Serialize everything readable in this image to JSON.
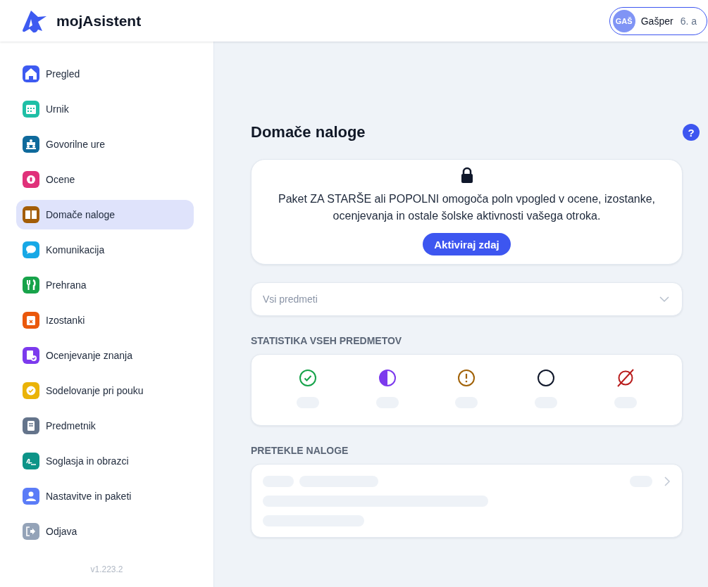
{
  "header": {
    "app_name": "mojAsistent",
    "user": {
      "initials": "GAŠ",
      "name": "Gašper",
      "class": "6. a"
    }
  },
  "sidebar": {
    "items": [
      {
        "label": "Pregled",
        "kind": "home",
        "color": "#3d5af1",
        "selected": false
      },
      {
        "label": "Urnik",
        "kind": "calendar",
        "color": "#1fbfa6",
        "selected": false
      },
      {
        "label": "Govorilne ure",
        "kind": "meeting",
        "color": "#0f6a9c",
        "selected": false
      },
      {
        "label": "Ocene",
        "kind": "grade",
        "color": "#e0317a",
        "selected": false
      },
      {
        "label": "Domače naloge",
        "kind": "book",
        "color": "#a35d07",
        "selected": true
      },
      {
        "label": "Komunikacija",
        "kind": "chat",
        "color": "#17a8e6",
        "selected": false
      },
      {
        "label": "Prehrana",
        "kind": "food",
        "color": "#17a34a",
        "selected": false
      },
      {
        "label": "Izostanki",
        "kind": "absence",
        "color": "#ea580c",
        "selected": false
      },
      {
        "label": "Ocenjevanje znanja",
        "kind": "test",
        "color": "#7c3aed",
        "selected": false
      },
      {
        "label": "Sodelovanje pri pouku",
        "kind": "badge",
        "color": "#eab308",
        "selected": false
      },
      {
        "label": "Predmetnik",
        "kind": "subjects",
        "color": "#64748b",
        "selected": false
      },
      {
        "label": "Soglasja in obrazci",
        "kind": "signature",
        "color": "#0d9488",
        "selected": false
      },
      {
        "label": "Nastavitve in paketi",
        "kind": "person",
        "color": "#5b7cf7",
        "selected": false
      },
      {
        "label": "Odjava",
        "kind": "logout",
        "color": "#94a3b8",
        "selected": false
      }
    ],
    "version": "v1.223.2"
  },
  "main": {
    "title": "Domače naloge",
    "help": "?",
    "notice": {
      "text": "Paket ZA STARŠE ali POPOLNI omogoča poln vpogled v ocene, izostanke, ocenjevanja in ostale šolske aktivnosti vašega otroka.",
      "button": "Aktiviraj zdaj"
    },
    "subject_filter": {
      "placeholder": "Vsi predmeti"
    },
    "stats_heading": "STATISTIKA VSEH PREDMETOV",
    "stats": [
      {
        "kind": "done",
        "color": "#16a34a"
      },
      {
        "kind": "partial",
        "color": "#7c3aed"
      },
      {
        "kind": "warning",
        "color": "#a16207"
      },
      {
        "kind": "empty",
        "color": "#0f172a"
      },
      {
        "kind": "none",
        "color": "#b91c1c"
      }
    ],
    "overdue_heading": "PRETEKLE NALOGE"
  }
}
